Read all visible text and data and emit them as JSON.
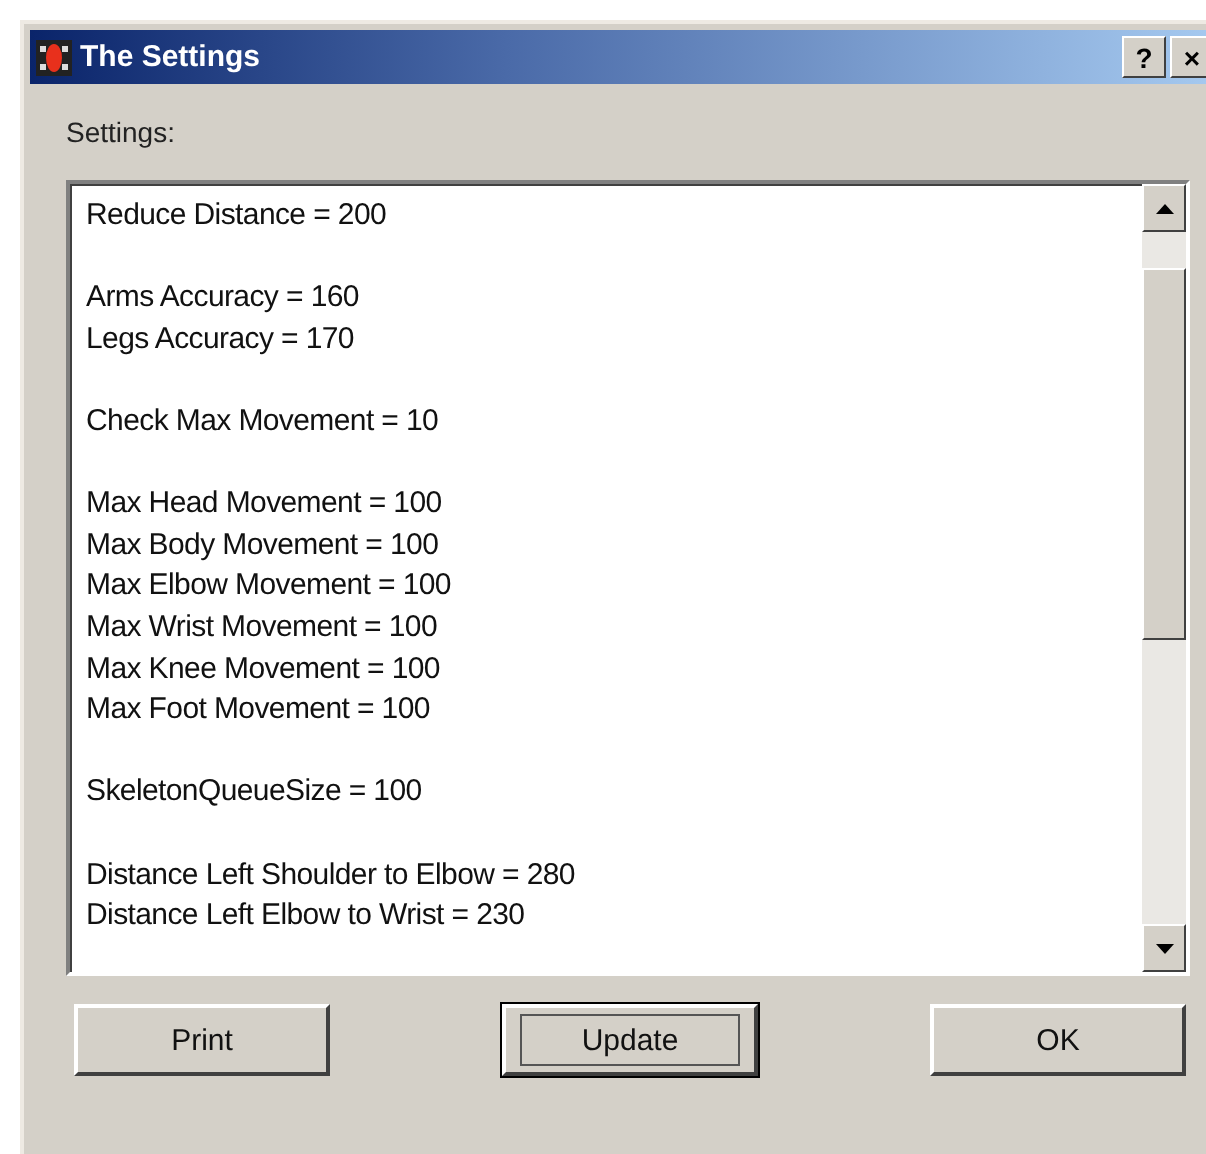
{
  "window": {
    "title": "The Settings",
    "title_buttons": [
      "?",
      "×"
    ]
  },
  "label": "Settings:",
  "settings_groups": [
    [
      "Reduce Distance = 200"
    ],
    [
      "Arms Accuracy = 160",
      "Legs Accuracy = 170"
    ],
    [
      "Check Max Movement = 10"
    ],
    [
      "Max Head Movement = 100",
      "Max Body Movement = 100",
      "Max Elbow Movement = 100",
      "Max Wrist Movement = 100",
      "Max Knee Movement = 100",
      "Max Foot Movement = 100"
    ],
    [
      "SkeletonQueueSize = 100"
    ],
    [
      "Distance Left Shoulder to Elbow = 280",
      "Distance Left Elbow to Wrist = 230"
    ]
  ],
  "buttons": [
    {
      "label": "Print",
      "default": false
    },
    {
      "label": "Update",
      "default": true
    },
    {
      "label": "OK",
      "default": false
    }
  ]
}
